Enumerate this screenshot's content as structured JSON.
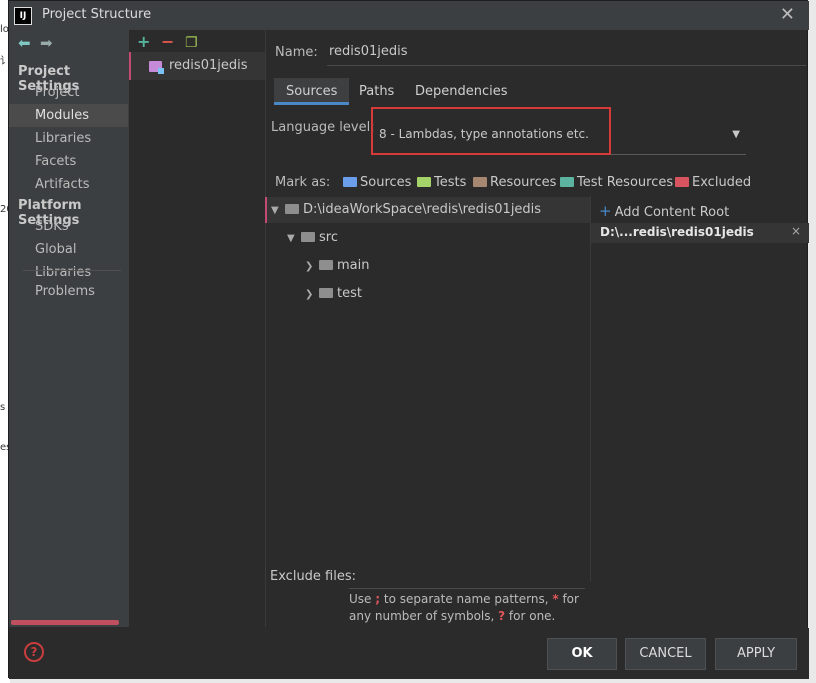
{
  "window": {
    "title": "Project Structure",
    "logo": "IJ"
  },
  "background_fragments": [
    "lo",
    "讠",
    "20",
    "s",
    "es"
  ],
  "nav": {
    "back_icon": "arrow-left",
    "forward_icon": "arrow-right",
    "project_settings_heading": "Project Settings",
    "project_settings_items": [
      "Project",
      "Modules",
      "Libraries",
      "Facets",
      "Artifacts"
    ],
    "platform_settings_heading": "Platform Settings",
    "platform_settings_items": [
      "SDKs",
      "Global Libraries"
    ],
    "problems_label": "Problems",
    "selected": "Modules"
  },
  "modules": {
    "add_symbol": "+",
    "remove_symbol": "−",
    "copy_icon": "copy-icon",
    "items": [
      "redis01jedis"
    ]
  },
  "details": {
    "name_label": "Name:",
    "name_value": "redis01jedis",
    "tabs": [
      "Sources",
      "Paths",
      "Dependencies"
    ],
    "active_tab": "Sources",
    "language_level_label": "Language level:",
    "language_level_value": "8 - Lambdas, type annotations etc.",
    "mark_as_label": "Mark as:",
    "mark_as_items": [
      {
        "label": "Sources",
        "color": "#6b9eea"
      },
      {
        "label": "Tests",
        "color": "#a4d36a"
      },
      {
        "label": "Resources",
        "color": "#a88770"
      },
      {
        "label": "Test Resources",
        "color": "#5cb3a0"
      },
      {
        "label": "Excluded",
        "color": "#d8545f"
      }
    ],
    "tree": {
      "root": "D:\\ideaWorkSpace\\redis\\redis01jedis",
      "src": "src",
      "main": "main",
      "test": "test"
    },
    "content_root": {
      "add_label": "Add Content Root",
      "entry": "D:\\...redis\\redis01jedis",
      "remove_symbol": "×"
    },
    "exclude_files_label": "Exclude files:",
    "exclude_files_value": "",
    "hint": {
      "part1": "Use ",
      "sym1": ";",
      "part2": " to separate name patterns, ",
      "sym2": "*",
      "part3": " for any number of symbols, ",
      "sym3": "?",
      "part4": " for one."
    }
  },
  "footer": {
    "help_symbol": "?",
    "ok_label": "OK",
    "cancel_label": "CANCEL",
    "apply_label": "APPLY"
  },
  "colors": {
    "accent_tab": "#4a88c7",
    "highlight_box": "#d83a3a",
    "module_marker": "#c54a72"
  }
}
